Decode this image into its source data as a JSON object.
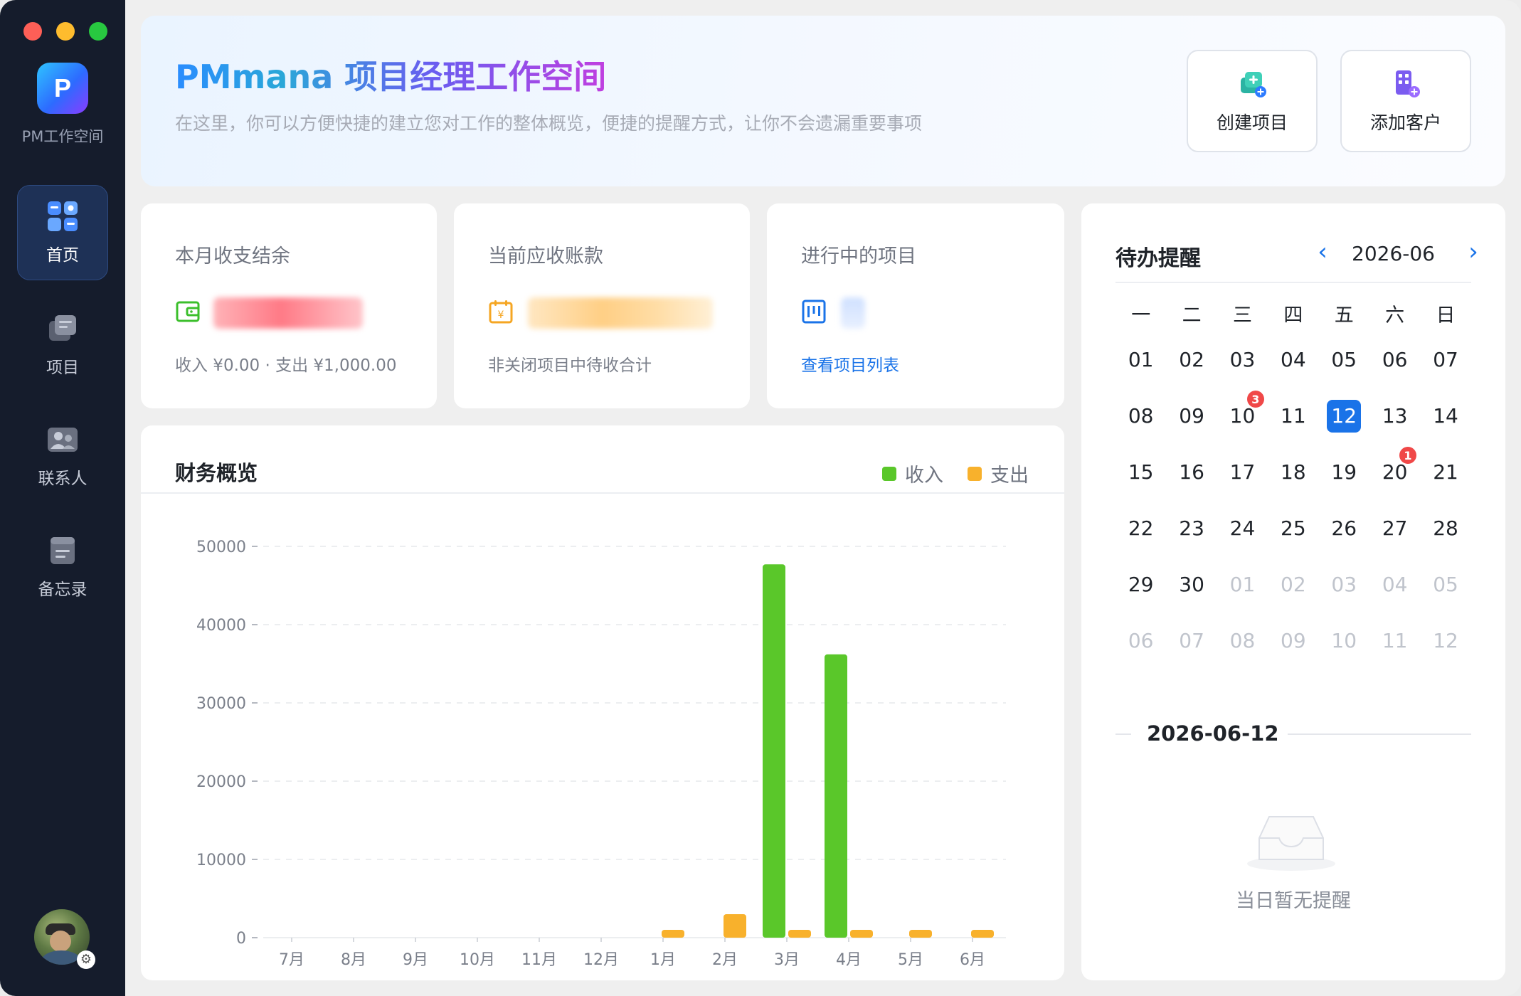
{
  "app": {
    "name": "PM工作空间",
    "logo_letter": "P"
  },
  "sidebar": {
    "items": [
      {
        "label": "首页",
        "icon": "dashboard-icon",
        "active": true
      },
      {
        "label": "项目",
        "icon": "projects-icon",
        "active": false
      },
      {
        "label": "联系人",
        "icon": "contacts-icon",
        "active": false
      },
      {
        "label": "备忘录",
        "icon": "memo-icon",
        "active": false
      }
    ]
  },
  "header": {
    "title": "PMmana 项目经理工作空间",
    "subtitle": "在这里，你可以方便快捷的建立您对工作的整体概览，便捷的提醒方式，让你不会遗漏重要事项",
    "create_project": "创建项目",
    "add_client": "添加客户"
  },
  "stats": {
    "balance": {
      "title": "本月收支结余",
      "footer": "收入 ¥0.00 · 支出 ¥1,000.00"
    },
    "receivable": {
      "title": "当前应收账款",
      "footer": "非关闭项目中待收合计"
    },
    "projects": {
      "title": "进行中的项目",
      "link": "查看项目列表"
    }
  },
  "finance": {
    "title": "财务概览",
    "legend_income": "收入",
    "legend_expense": "支出"
  },
  "chart_data": {
    "type": "bar",
    "categories": [
      "7月",
      "8月",
      "9月",
      "10月",
      "11月",
      "12月",
      "1月",
      "2月",
      "3月",
      "4月",
      "5月",
      "6月"
    ],
    "series": [
      {
        "name": "收入",
        "color": "#5ac72a",
        "values": [
          0,
          0,
          0,
          0,
          0,
          0,
          0,
          0,
          47700,
          36200,
          0,
          0
        ]
      },
      {
        "name": "支出",
        "color": "#f8b12c",
        "values": [
          0,
          0,
          0,
          0,
          0,
          0,
          1000,
          3000,
          1000,
          1000,
          1000,
          1000
        ]
      }
    ],
    "ylim": [
      0,
      50000
    ],
    "yticks": [
      0,
      10000,
      20000,
      30000,
      40000,
      50000
    ],
    "grid": true,
    "legend": "top-right"
  },
  "calendar": {
    "title": "待办提醒",
    "month": "2026-06",
    "weekdays": [
      "一",
      "二",
      "三",
      "四",
      "五",
      "六",
      "日"
    ],
    "weeks": [
      [
        {
          "d": "01"
        },
        {
          "d": "02"
        },
        {
          "d": "03"
        },
        {
          "d": "04"
        },
        {
          "d": "05"
        },
        {
          "d": "06"
        },
        {
          "d": "07"
        }
      ],
      [
        {
          "d": "08"
        },
        {
          "d": "09"
        },
        {
          "d": "10",
          "badge": "3"
        },
        {
          "d": "11"
        },
        {
          "d": "12",
          "today": true
        },
        {
          "d": "13"
        },
        {
          "d": "14"
        }
      ],
      [
        {
          "d": "15"
        },
        {
          "d": "16"
        },
        {
          "d": "17"
        },
        {
          "d": "18"
        },
        {
          "d": "19"
        },
        {
          "d": "20",
          "badge": "1"
        },
        {
          "d": "21"
        }
      ],
      [
        {
          "d": "22"
        },
        {
          "d": "23"
        },
        {
          "d": "24"
        },
        {
          "d": "25"
        },
        {
          "d": "26"
        },
        {
          "d": "27"
        },
        {
          "d": "28"
        }
      ],
      [
        {
          "d": "29"
        },
        {
          "d": "30"
        },
        {
          "d": "01",
          "dim": true
        },
        {
          "d": "02",
          "dim": true
        },
        {
          "d": "03",
          "dim": true
        },
        {
          "d": "04",
          "dim": true
        },
        {
          "d": "05",
          "dim": true
        }
      ],
      [
        {
          "d": "06",
          "dim": true
        },
        {
          "d": "07",
          "dim": true
        },
        {
          "d": "08",
          "dim": true
        },
        {
          "d": "09",
          "dim": true
        },
        {
          "d": "10",
          "dim": true
        },
        {
          "d": "11",
          "dim": true
        },
        {
          "d": "12",
          "dim": true
        }
      ]
    ],
    "selected_date": "2026-06-12",
    "empty_text": "当日暂无提醒"
  },
  "colors": {
    "accent": "#1a73e8",
    "income": "#5ac72a",
    "expense": "#f8b12c",
    "badge": "#f04848",
    "sidebar_bg": "#151c2c"
  }
}
